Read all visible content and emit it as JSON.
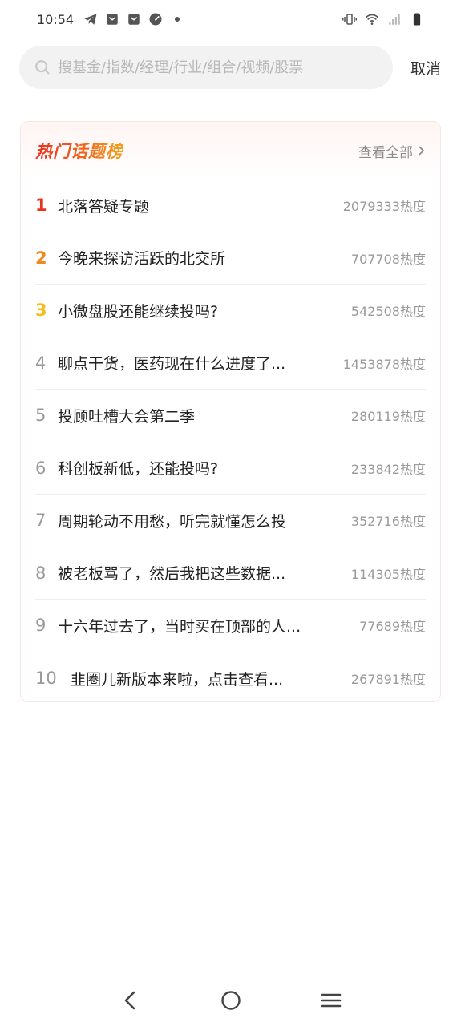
{
  "status_bar": {
    "time": "10:54",
    "left_icons": [
      "telegram-icon",
      "mail-icon",
      "mail-icon",
      "gauge-icon"
    ],
    "right_icons": [
      "vibrate-icon",
      "wifi-icon",
      "signal-icon",
      "battery-icon"
    ]
  },
  "search": {
    "placeholder": "搜基金/指数/经理/行业/组合/视频/股票",
    "value": "",
    "cancel_label": "取消"
  },
  "hot_topics": {
    "title": "热门话题榜",
    "view_all_label": "查看全部",
    "items": [
      {
        "rank": "1",
        "title": "北落答疑专题",
        "heat": "2079333热度"
      },
      {
        "rank": "2",
        "title": "今晚来探访活跃的北交所",
        "heat": "707708热度"
      },
      {
        "rank": "3",
        "title": "小微盘股还能继续投吗?",
        "heat": "542508热度"
      },
      {
        "rank": "4",
        "title": "聊点干货，医药现在什么进度了...",
        "heat": "1453878热度"
      },
      {
        "rank": "5",
        "title": "投顾吐槽大会第二季",
        "heat": "280119热度"
      },
      {
        "rank": "6",
        "title": "科创板新低，还能投吗?",
        "heat": "233842热度"
      },
      {
        "rank": "7",
        "title": "周期轮动不用愁，听完就懂怎么投",
        "heat": "352716热度"
      },
      {
        "rank": "8",
        "title": "被老板骂了，然后我把这些数据...",
        "heat": "114305热度"
      },
      {
        "rank": "9",
        "title": "十六年过去了，当时买在顶部的人...",
        "heat": "77689热度"
      },
      {
        "rank": "10",
        "title": "韭圈儿新版本来啦，点击查看...",
        "heat": "267891热度"
      }
    ]
  },
  "colors": {
    "rank1": "#e8321f",
    "rank2": "#f08a1d",
    "rank3": "#f3bf1c",
    "muted": "#9a9a9a"
  }
}
